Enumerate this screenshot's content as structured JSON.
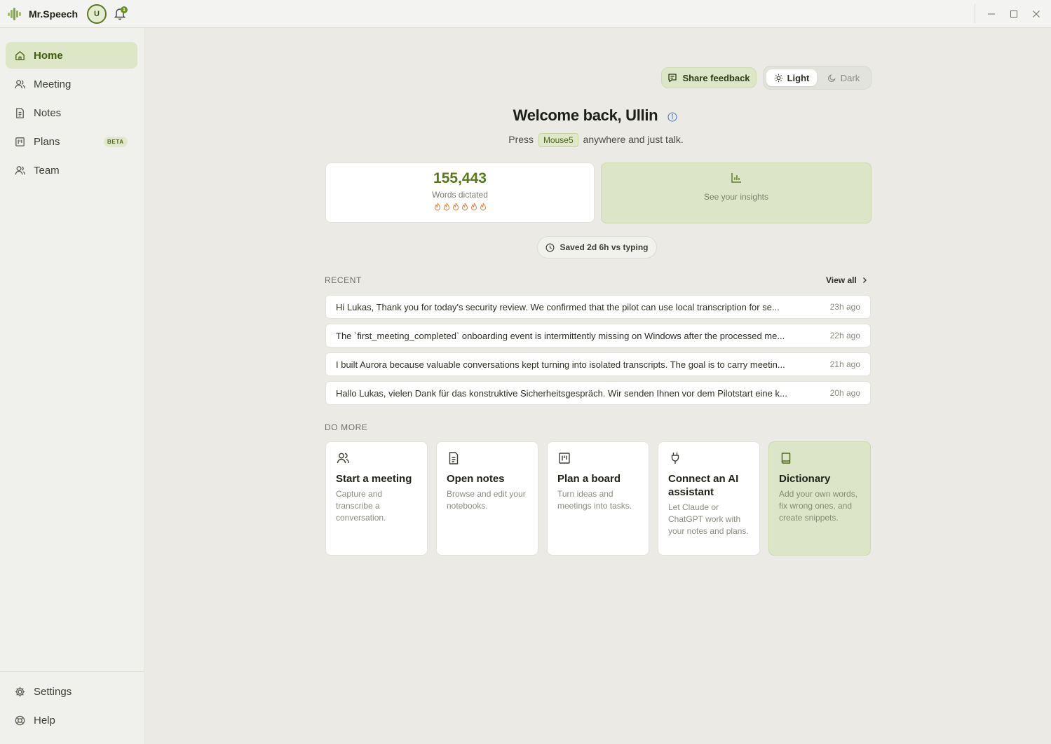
{
  "app": {
    "name": "Mr.Speech",
    "avatar_initial": "U",
    "notification_count": "1"
  },
  "colors": {
    "accent": "#587a1c",
    "accent_soft": "#dde6c7",
    "background": "#ebeae5"
  },
  "sidebar": {
    "items": [
      {
        "label": "Home",
        "icon": "home-icon",
        "active": true
      },
      {
        "label": "Meeting",
        "icon": "users-icon"
      },
      {
        "label": "Notes",
        "icon": "document-icon"
      },
      {
        "label": "Plans",
        "icon": "board-icon",
        "badge": "BETA"
      },
      {
        "label": "Team",
        "icon": "user-icon"
      }
    ],
    "bottom": [
      {
        "label": "Settings",
        "icon": "gear-icon"
      },
      {
        "label": "Help",
        "icon": "lifebuoy-icon"
      }
    ]
  },
  "header": {
    "feedback_label": "Share feedback",
    "theme": {
      "light_label": "Light",
      "dark_label": "Dark",
      "selected": "Light"
    }
  },
  "welcome": {
    "title": "Welcome back, Ullin",
    "hint_prefix": "Press",
    "hint_key": "Mouse5",
    "hint_suffix": "anywhere and just talk."
  },
  "stats": {
    "words_value": "155,443",
    "words_label": "Words dictated",
    "streak_flames": 6,
    "insights_label": "See your insights",
    "saved_label": "Saved 2d 6h vs typing"
  },
  "recent": {
    "label": "RECENT",
    "view_all": "View all",
    "items": [
      {
        "text": "Hi Lukas, Thank you for today's security review. We confirmed that the pilot can use local transcription for se...",
        "time": "23h ago"
      },
      {
        "text": "The `first_meeting_completed` onboarding event is intermittently missing on Windows after the processed me...",
        "time": "22h ago"
      },
      {
        "text": "I built Aurora because valuable conversations kept turning into isolated transcripts. The goal is to carry meetin...",
        "time": "21h ago"
      },
      {
        "text": "Hallo Lukas, vielen Dank für das konstruktive Sicherheitsgespräch. Wir senden Ihnen vor dem Pilotstart eine k...",
        "time": "20h ago"
      }
    ]
  },
  "do_more": {
    "label": "DO MORE",
    "cards": [
      {
        "title": "Start a meeting",
        "desc": "Capture and transcribe a conversation.",
        "icon": "users-icon"
      },
      {
        "title": "Open notes",
        "desc": "Browse and edit your notebooks.",
        "icon": "document-icon"
      },
      {
        "title": "Plan a board",
        "desc": "Turn ideas and meetings into tasks.",
        "icon": "board-icon"
      },
      {
        "title": "Connect an AI assistant",
        "desc": "Let Claude or ChatGPT work with your notes and plans.",
        "icon": "plug-icon"
      },
      {
        "title": "Dictionary",
        "desc": "Add your own words, fix wrong ones, and create snippets.",
        "icon": "book-icon"
      }
    ]
  }
}
